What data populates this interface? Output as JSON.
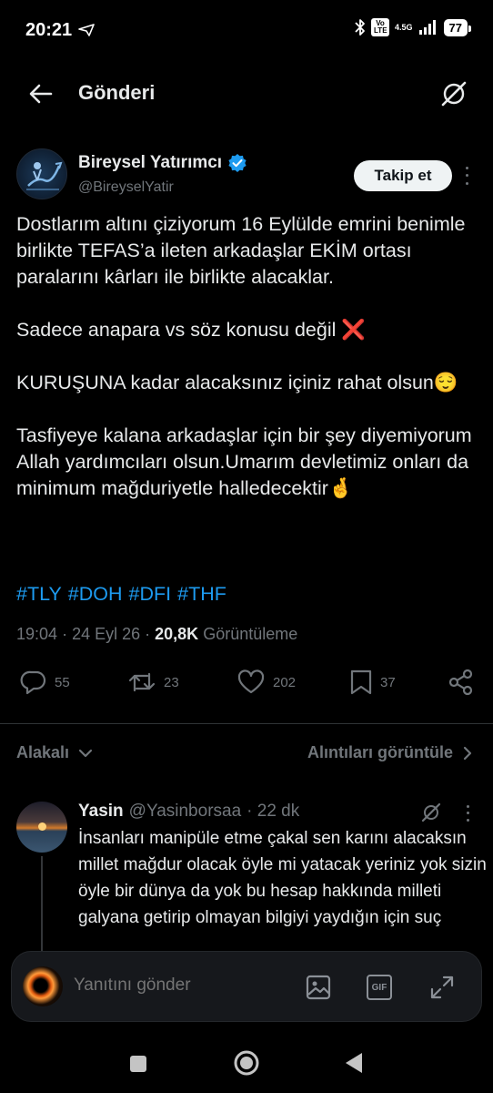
{
  "status_bar": {
    "time": "20:21",
    "volte_label": "Vo LTE",
    "network": "4.5G",
    "battery": "77"
  },
  "header": {
    "title": "Gönderi"
  },
  "tweet": {
    "author_name": "Bireysel Yatırımcı",
    "author_handle": "@BireyselYatir",
    "follow_label": "Takip et",
    "paragraphs": [
      "Dostlarım altını çiziyorum 16 Eylülde emrini benimle birlikte TEFAS’a ileten arkadaşlar EKİM ortası paralarını kârları ile birlikte alacaklar.",
      "Sadece anapara vs söz konusu değil ❌",
      "KURUŞUNA kadar alacaksınız içiniz rahat olsun😌",
      "Tasfiyeye kalana arkadaşlar için bir şey diyemiyorum Allah yardımcıları olsun.Umarım devletimiz onları da minimum mağduriyetle halledecektir🤞"
    ],
    "hashtags": [
      "#TLY",
      "#DOH",
      "#DFI",
      "#THF"
    ],
    "time": "19:04",
    "date": "24 Eyl 26",
    "views_count": "20,8K",
    "views_label": "Görüntüleme",
    "replies": "55",
    "retweets": "23",
    "likes": "202",
    "bookmarks": "37"
  },
  "related": {
    "label": "Alakalı",
    "quotes_label": "Alıntıları görüntüle"
  },
  "reply": {
    "name": "Yasin",
    "handle": "@Yasinborsaa",
    "time": "· 22 dk",
    "text": "İnsanları manipüle etme çakal sen karını alacaksın millet mağdur olacak öyle mi yatacak yeriniz yok sizin öyle bir dünya da yok bu hesap hakkında milleti galyana getirip olmayan bilgiyi yaydığın için suç"
  },
  "composer": {
    "placeholder": "Yanıtını gönder",
    "gif_label": "GIF"
  },
  "colors": {
    "accent": "#1d9bf0",
    "muted": "#71767b",
    "text": "#e7e9ea",
    "background": "#000000"
  }
}
